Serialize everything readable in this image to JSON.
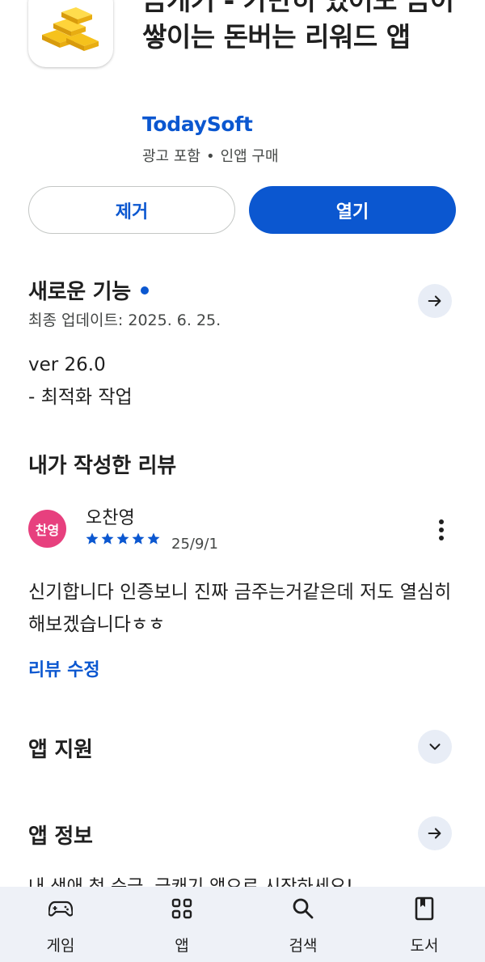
{
  "app": {
    "title": "금캐기 - 가만히 있어도 금이 쌓이는 돈버는 리워드 앱",
    "developer": "TodaySoft",
    "meta_ads": "광고 포함",
    "meta_iap": "인앱 구매",
    "icon": "gold-bars-icon"
  },
  "actions": {
    "remove_label": "제거",
    "open_label": "열기"
  },
  "whats_new": {
    "title": "새로운 기능",
    "updated": "최종 업데이트: 2025. 6. 25.",
    "version": "ver 26.0",
    "notes": "- 최적화 작업"
  },
  "my_review": {
    "title": "내가 작성한 리뷰",
    "avatar_text": "찬영",
    "avatar_color": "#e7407e",
    "reviewer": "오찬영",
    "rating": 5,
    "rating_max": 5,
    "date": "25/9/1",
    "text": "신기합니다 인증보니 진짜 금주는거같은데 저도 열심히 해보겠습니다ㅎㅎ",
    "edit_label": "리뷰 수정"
  },
  "app_support": {
    "title": "앱 지원"
  },
  "app_info": {
    "title": "앱 정보",
    "teaser": "내 생애 첫 순금, 금캐기 앱으로 시작하세요!"
  },
  "bottom_nav": {
    "items": [
      {
        "label": "게임",
        "icon": "gamepad-icon"
      },
      {
        "label": "앱",
        "icon": "apps-grid-icon"
      },
      {
        "label": "검색",
        "icon": "search-icon"
      },
      {
        "label": "도서",
        "icon": "book-icon"
      }
    ]
  },
  "colors": {
    "accent": "#0b57d0",
    "nav_background": "#eef1f7",
    "chip_background": "#e8edf6"
  }
}
